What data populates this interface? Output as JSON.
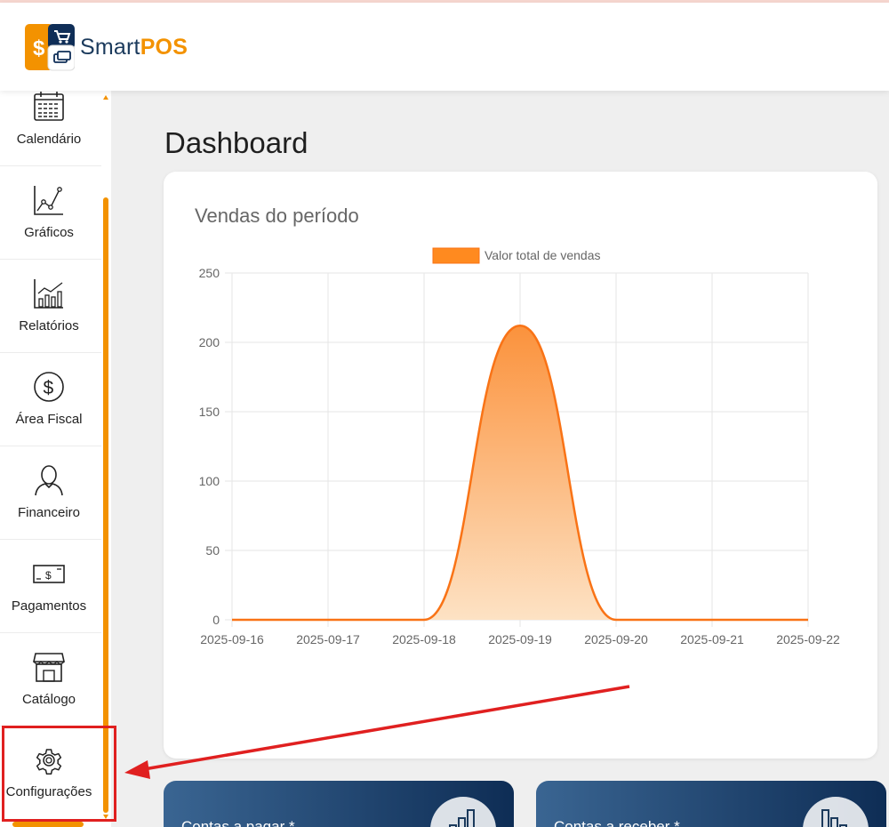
{
  "app": {
    "brand_regular": "Smart",
    "brand_bold": "POS"
  },
  "sidebar": {
    "items": [
      {
        "label": "Calendário",
        "icon": "calendar-icon"
      },
      {
        "label": "Gráficos",
        "icon": "line-chart-icon"
      },
      {
        "label": "Relatórios",
        "icon": "bar-chart-icon"
      },
      {
        "label": "Área Fiscal",
        "icon": "dollar-circle-icon"
      },
      {
        "label": "Financeiro",
        "icon": "person-icon"
      },
      {
        "label": "Pagamentos",
        "icon": "banknote-icon"
      },
      {
        "label": "Catálogo",
        "icon": "storefront-icon"
      },
      {
        "label": "Configurações",
        "icon": "gear-icon"
      }
    ]
  },
  "main": {
    "title": "Dashboard",
    "chart_card_title": "Vendas do período",
    "stat_cards": [
      {
        "label": "Contas a pagar *",
        "icon": "bar-chart-up-icon"
      },
      {
        "label": "Contas a receber *",
        "icon": "bar-chart-down-icon"
      }
    ]
  },
  "colors": {
    "brand_orange": "#f39200",
    "brand_navy": "#1b3a5c",
    "chart_line": "#f97316",
    "chart_fill_top": "#fb923c",
    "annotation_red": "#e02020"
  },
  "chart_data": {
    "type": "area",
    "title": "",
    "legend": [
      "Valor total de vendas"
    ],
    "legend_position": "top",
    "categories": [
      "2025-09-16",
      "2025-09-17",
      "2025-09-18",
      "2025-09-19",
      "2025-09-20",
      "2025-09-21",
      "2025-09-22"
    ],
    "series": [
      {
        "name": "Valor total de vendas",
        "values": [
          0,
          0,
          0,
          212,
          0,
          0,
          0
        ]
      }
    ],
    "yticks": [
      0,
      50,
      100,
      150,
      200,
      250
    ],
    "ylim": [
      0,
      250
    ],
    "grid": true,
    "smooth": true
  }
}
